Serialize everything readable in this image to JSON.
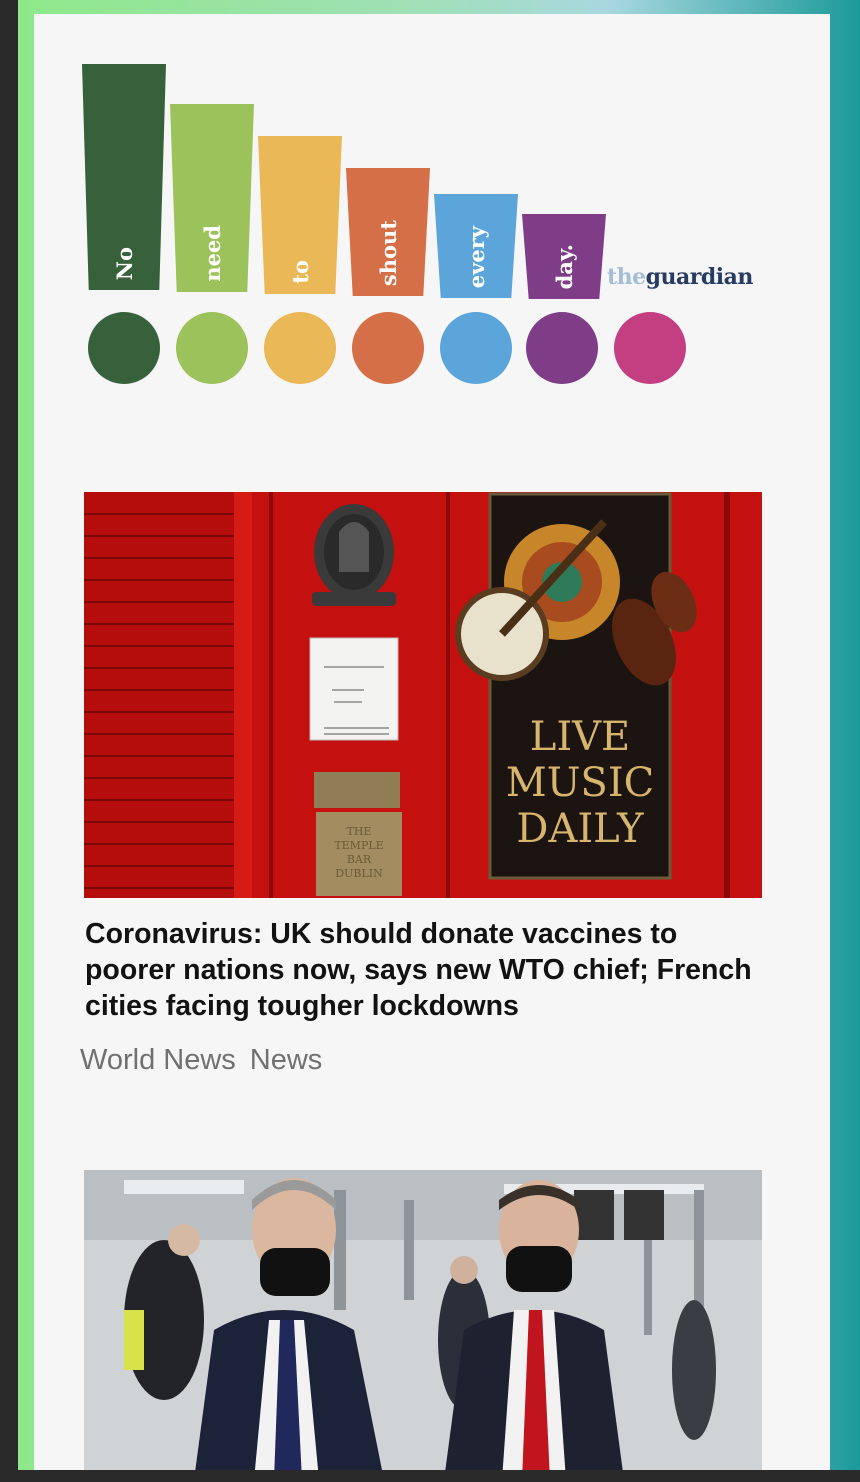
{
  "banner": {
    "words": [
      "No",
      "need",
      "to",
      "shout",
      "every",
      "day."
    ],
    "brand_the": "the",
    "brand_guardian": "guardian"
  },
  "colors": {
    "dark_green": "#36613a",
    "light_green": "#9cc25b",
    "yellow": "#ebb857",
    "orange": "#d46f47",
    "blue": "#5ca5da",
    "purple": "#7f3d87",
    "pink": "#c43e82"
  },
  "articles": [
    {
      "image_text": {
        "sign_line1": "LIVE",
        "sign_line2": "MUSIC",
        "sign_line3": "DAILY",
        "plaque_line1": "THE",
        "plaque_line2": "TEMPLE",
        "plaque_line3": "BAR",
        "plaque_line4": "DUBLIN"
      },
      "headline": "Coronavirus: UK should donate vaccines to poorer nations now, says new WTO chief; French cities facing tougher lockdowns",
      "tags": [
        "World News",
        "News"
      ]
    },
    {
      "headline": ""
    }
  ]
}
